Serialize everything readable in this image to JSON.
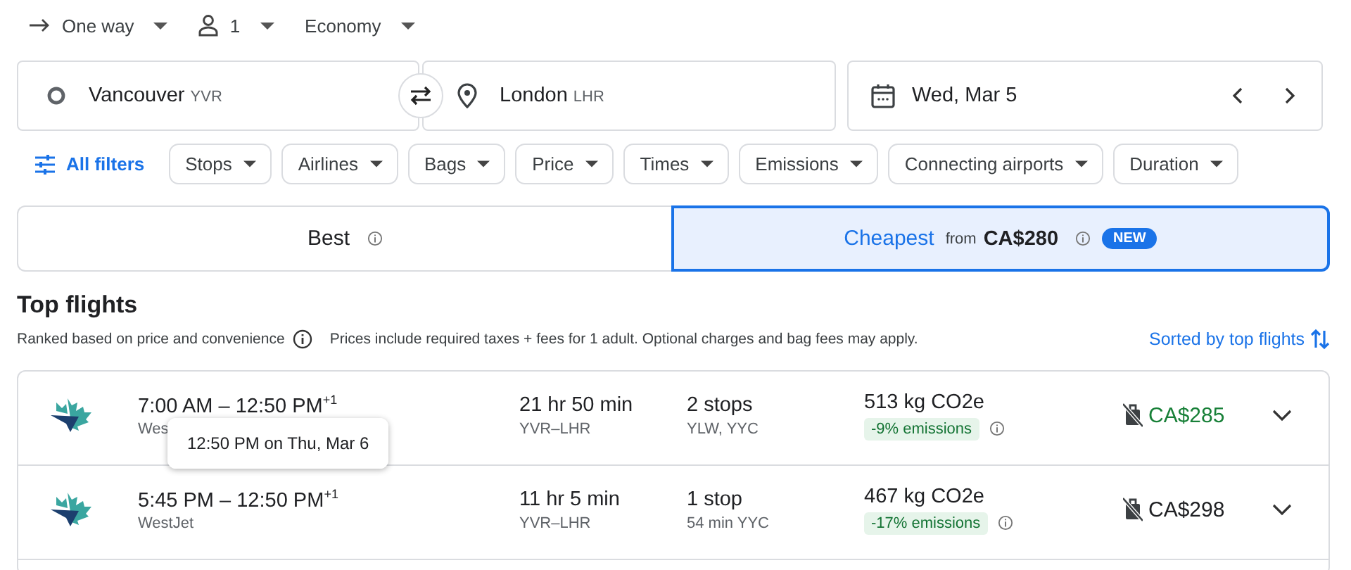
{
  "trip_options": [
    {
      "kind": "trip",
      "label": "One way"
    },
    {
      "kind": "passengers",
      "label": "1"
    },
    {
      "kind": "class",
      "label": "Economy"
    }
  ],
  "search": {
    "origin": {
      "city": "Vancouver",
      "code": "YVR"
    },
    "destination": {
      "city": "London",
      "code": "LHR"
    },
    "date": "Wed, Mar 5"
  },
  "filters": {
    "all_filters": "All filters",
    "chips": [
      "Stops",
      "Airlines",
      "Bags",
      "Price",
      "Times",
      "Emissions",
      "Connecting airports",
      "Duration"
    ]
  },
  "sort_tabs": [
    {
      "label": "Best",
      "selected": false
    },
    {
      "label": "Cheapest",
      "from": "from",
      "price": "CA$280",
      "badge": "NEW",
      "selected": true
    }
  ],
  "section": {
    "title": "Top flights",
    "note": "Ranked based on price and convenience",
    "prices_note": "Prices include required taxes + fees for 1 adult. Optional charges and bag fees may apply.",
    "sort": "Sorted by top flights"
  },
  "flights": [
    {
      "times": "7:00 AM – 12:50 PM",
      "day_offset": "+1",
      "airline": "Wes",
      "duration": "21 hr 50 min",
      "route": "YVR–LHR",
      "stops": "2 stops",
      "stop_detail": "YLW, YYC",
      "emissions": "513 kg CO2e",
      "emissions_change": "-9% emissions",
      "price": "CA$285",
      "price_highlight": true
    },
    {
      "times": "5:45 PM – 12:50 PM",
      "day_offset": "+1",
      "airline": "WestJet",
      "duration": "11 hr 5 min",
      "route": "YVR–LHR",
      "stops": "1 stop",
      "stop_detail": "54 min YYC",
      "emissions": "467 kg CO2e",
      "emissions_change": "-17% emissions",
      "price": "CA$298",
      "price_highlight": false
    }
  ],
  "tooltip": {
    "text": "12:50 PM on Thu, Mar 6"
  }
}
